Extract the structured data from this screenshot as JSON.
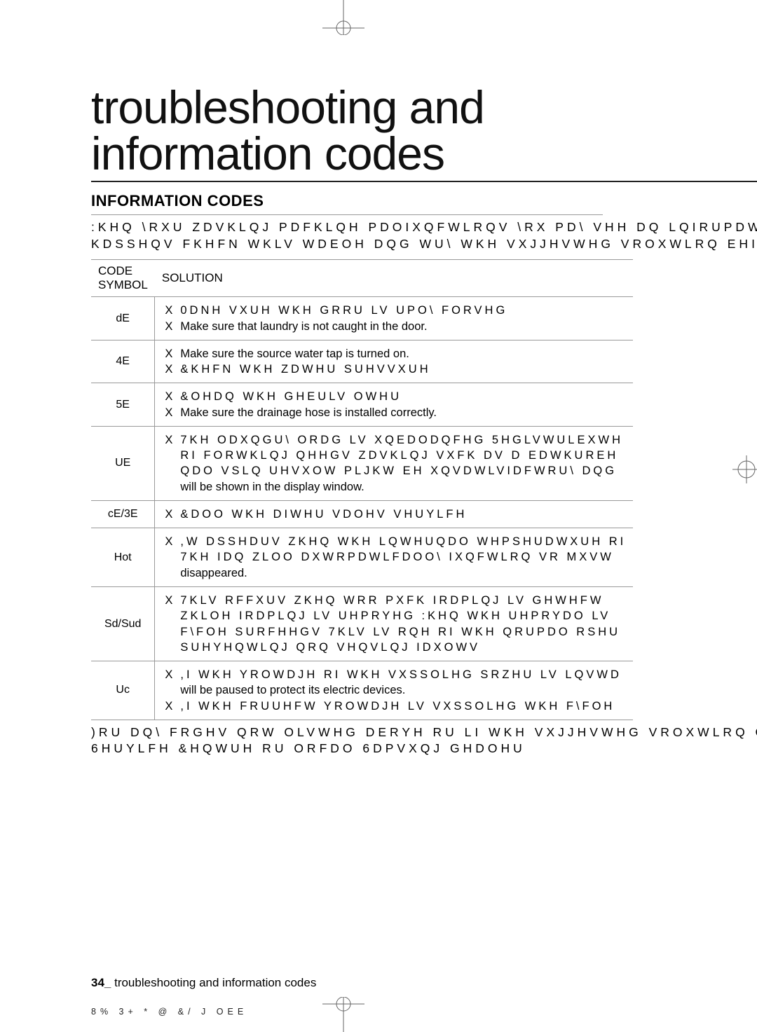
{
  "title_line1": "troubleshooting and",
  "title_line2": "information codes",
  "section_title": "INFORMATION CODES",
  "intro_line1": ":KHQ \\RXU ZDVKLQJ PDFKLQH PDOIXQFWLRQV  \\RX PD\\ VHH DQ LQIRUPDWL",
  "intro_line2": "KDSSHQV  FKHFN WKLV WDEOH DQG WU\\ WKH VXJJHVWHG VROXWLRQ EHIRU",
  "th_code": "CODE SYMBOL",
  "th_solution": "SOLUTION",
  "rows": [
    {
      "code": "dE",
      "items": [
        {
          "g": "0DNH VXUH WKH GRRU LV  UPO\\ FORVHG"
        },
        {
          "t": "Make sure that laundry is not caught in the door."
        }
      ]
    },
    {
      "code": "4E",
      "items": [
        {
          "t": "Make sure the source water tap is turned on."
        },
        {
          "g": "&KHFN WKH ZDWHU SUHVVXUH"
        }
      ]
    },
    {
      "code": "5E",
      "items": [
        {
          "g": "&OHDQ WKH GHEULV  OWHU"
        },
        {
          "t": "Make sure the drainage hose is installed correctly."
        }
      ]
    },
    {
      "code": "UE",
      "items": [
        {
          "g": "7KH ODXQGU\\ ORDG LV XQEDODQFHG  5HGLVWULEXWH",
          "cont_g": [
            "RI FORWKLQJ QHHGV ZDVKLQJ  VXFK DV D EDWKUREH",
            "QDO VSLQ UHVXOW PLJKW EH XQVDWLVIDFWRU\\ DQG"
          ],
          "cont_t": "will be shown in the display window."
        }
      ]
    },
    {
      "code": "cE/3E",
      "items": [
        {
          "g": "&DOO WKH DIWHU VDOHV VHUYLFH"
        }
      ]
    },
    {
      "code": "Hot",
      "items": [
        {
          "g": ",W DSSHDUV ZKHQ WKH LQWHUQDO WHPSHUDWXUH RI",
          "cont_g": [
            "7KH IDQ ZLOO DXWRPDWLFDOO\\ IXQFWLRQ  VR MXVW"
          ],
          "cont_t": "disappeared."
        }
      ]
    },
    {
      "code": "Sd/Sud",
      "items": [
        {
          "g": "7KLV RFFXUV ZKHQ WRR PXFK IRDPLQJ LV GHWHFW",
          "cont_g": [
            "ZKLOH IRDPLQJ LV UHPRYHG  :KHQ WKH UHPRYDO LV",
            "F\\FOH SURFHHGV  7KLV LV RQH RI WKH QRUPDO RSHU",
            "SUHYHQWLQJ QRQ VHQVLQJ IDXOWV"
          ]
        }
      ]
    },
    {
      "code": "Uc",
      "items": [
        {
          "g": ",I WKH YROWDJH RI WKH VXSSOLHG SRZHU LV LQVWD",
          "cont_t": "will be paused to protect its electric devices."
        },
        {
          "g": ",I WKH FRUUHFW YROWDJH LV VXSSOLHG  WKH F\\FOH"
        }
      ]
    }
  ],
  "outro_line1": ")RU DQ\\ FRGHV QRW OLVWHG DERYH  RU LI WKH VXJJHVWHG VROXWLRQ GR",
  "outro_line2": "6HUYLFH &HQWUH RU ORFDO 6DPVXQJ GHDOHU",
  "footer_pagenum": "34_",
  "footer_chapter": " troubleshooting and information codes",
  "file_footer": "8%    3+      *  @ &/ J OEE"
}
